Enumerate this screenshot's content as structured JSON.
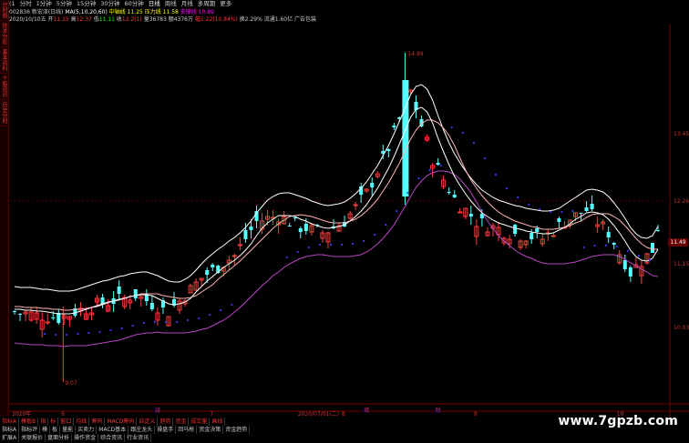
{
  "toolbar": {
    "tabs": [
      "分时图",
      "技术分析",
      "基本资料",
      "个股资讯",
      "历史分时"
    ]
  },
  "topbar": {
    "items": [
      "(1",
      "分时",
      "1分钟",
      "5分钟",
      "15分钟",
      "30分钟",
      "60分钟",
      "日线",
      "周线",
      "月线",
      "多周期",
      "更多"
    ],
    "active_index": 7
  },
  "info_line1": {
    "code": "002836",
    "name": "新宏泽(日线)",
    "ma": "MA(5,10,20,60)",
    "indicator": "中轴线 11.25 压力线 11.58",
    "support": "支撑线 10.89"
  },
  "info_line2": {
    "date": "2020/10/10五",
    "open_label": "开",
    "open_val": "11.15",
    "high_label": "高",
    "high_val": "12.37",
    "low_label": "低",
    "low_val": "11.11",
    "close_label": "收",
    "close_val": "12.2(1)",
    "vol": "量36783",
    "amount": "额4376万",
    "change": "幅1.22(10.84%)",
    "turnover": "换2.29%",
    "float": "流通1.60亿",
    "industry": "广告包装"
  },
  "chart": {
    "price_labels": [
      {
        "price": 13.45,
        "text": "13.45"
      },
      {
        "price": 12.26,
        "text": "12.26"
      },
      {
        "price": 11.15,
        "text": "11.15"
      },
      {
        "price": 10.03,
        "text": "10.03"
      }
    ],
    "current_price": "11.49",
    "high_label": "14.89",
    "low_label": "9.07",
    "signals": [
      {
        "text": "减",
        "idx": 26
      },
      {
        "text": "增",
        "idx": 64
      },
      {
        "text": "财",
        "idx": 77
      }
    ],
    "date_labels": [
      {
        "text": "2020年",
        "idx": 0
      },
      {
        "text": "2020/07/01(二)",
        "idx": 52
      }
    ],
    "month_labels": [
      {
        "text": "6",
        "idx": 9
      },
      {
        "text": "7",
        "idx": 36
      },
      {
        "text": "8",
        "idx": 60
      },
      {
        "text": "9",
        "idx": 84
      },
      {
        "text": "10",
        "idx": 110
      }
    ],
    "colors": {
      "up": "#ff3c3c",
      "down": "#54ffff",
      "ma_white": "#ffffff",
      "ma_pink": "#ffb4b4",
      "band": "#b946c6",
      "dots": "#3b3bff"
    }
  },
  "bottom": {
    "row1": [
      "指标A",
      "模板B",
      "指",
      "标",
      "窗口",
      "均线",
      "筹码",
      "MACD筹码",
      "自定义",
      "趋势",
      "资金",
      "成交量",
      "画线"
    ],
    "row2": [
      "指标A",
      "指标评",
      "模",
      "板",
      "量能",
      "买卖力",
      "MACD基本",
      "跟庄龙头",
      "操盘手",
      "回马枪",
      "资金决策",
      "资金趋势"
    ],
    "row3": [
      "扩展A",
      "关联报价",
      "盘面分析",
      "操作资金",
      "综合资讯",
      "行业资讯"
    ]
  },
  "watermark": "www.7gpzb.com"
}
